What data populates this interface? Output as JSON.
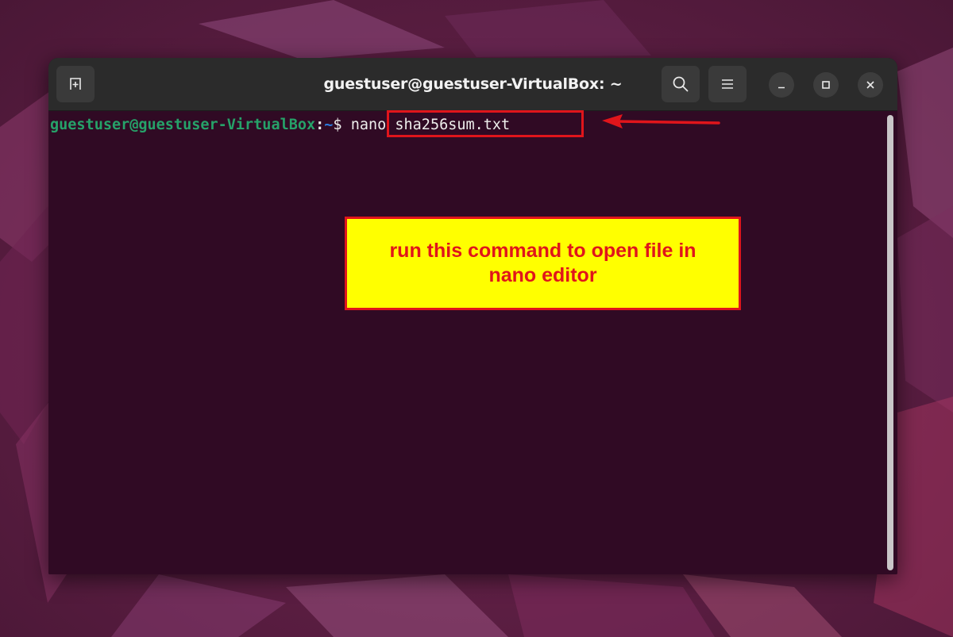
{
  "window": {
    "title": "guestuser@guestuser-VirtualBox: ~",
    "buttons": {
      "new_tab_icon": "new-tab-icon",
      "search_icon": "search-icon",
      "menu_icon": "hamburger-menu-icon",
      "minimize_icon": "minimize-icon",
      "maximize_icon": "maximize-icon",
      "close_icon": "close-icon"
    }
  },
  "terminal": {
    "prompt_user": "guestuser@guestuser-VirtualBox",
    "prompt_sep": ":",
    "prompt_path": "~",
    "prompt_dollar": "$ ",
    "command": "nano sha256sum.txt"
  },
  "annotation": {
    "callout_text": "run this command to open file in nano editor",
    "color": "#e0151b",
    "callout_bg": "#ffff00"
  },
  "colors": {
    "terminal_bg": "#300a24",
    "titlebar_bg": "#2b2b2b",
    "prompt_green": "#26a269",
    "prompt_blue": "#2a7bde"
  }
}
